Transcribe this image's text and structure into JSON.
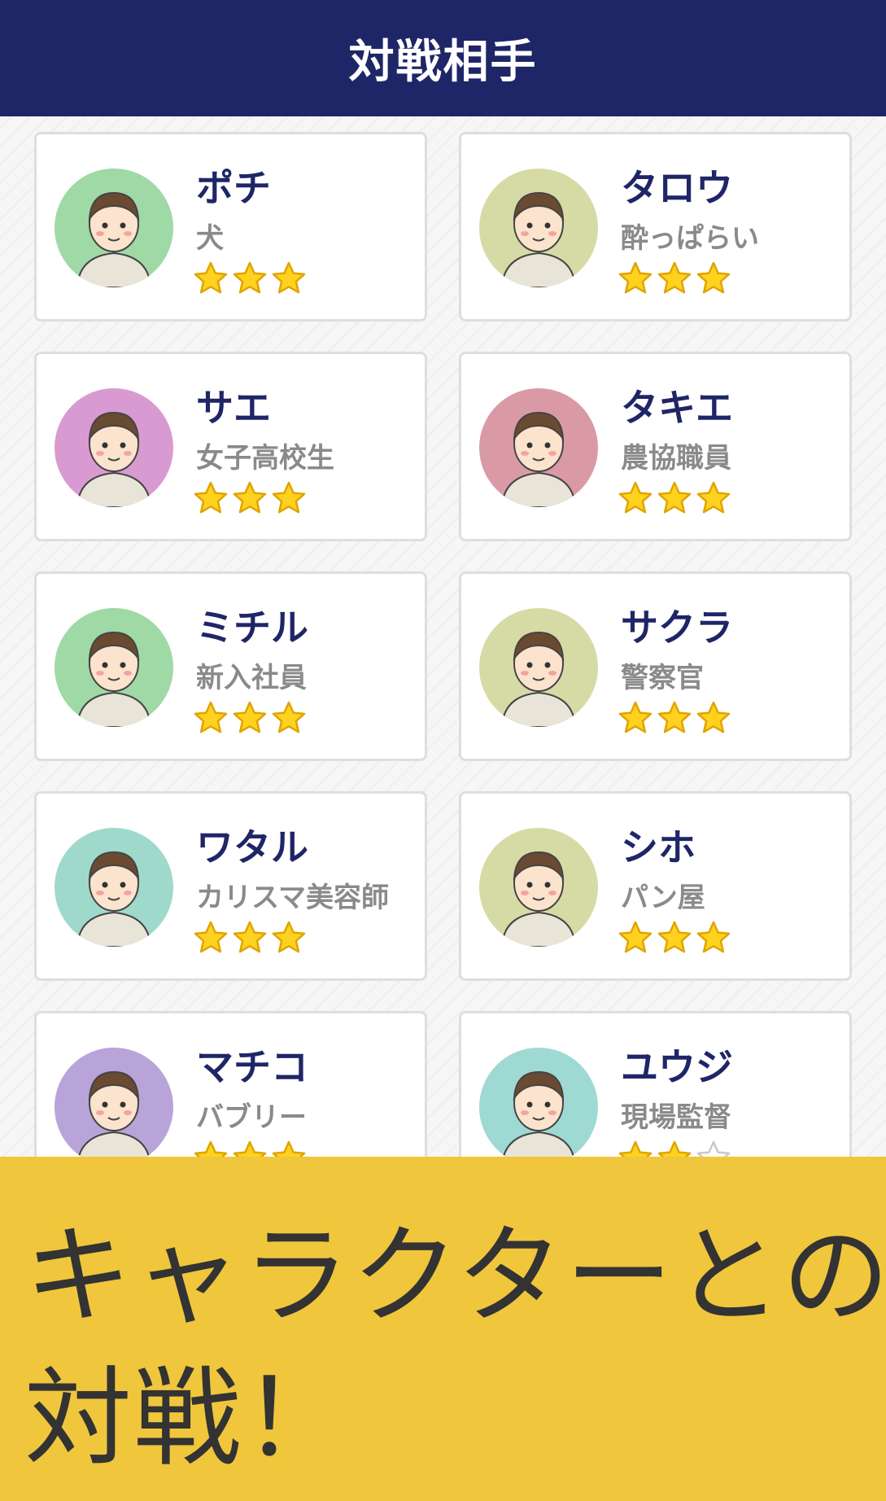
{
  "header": {
    "title": "対戦相手"
  },
  "opponents": [
    {
      "name": "ポチ",
      "role": "犬",
      "stars": 3,
      "avatar_bg": "#9fd9a6",
      "avatar": "shiba-dog-avatar"
    },
    {
      "name": "タロウ",
      "role": "酔っぱらい",
      "stars": 3,
      "avatar_bg": "#d6dba5",
      "avatar": "drunk-man-avatar"
    },
    {
      "name": "サエ",
      "role": "女子高校生",
      "stars": 3,
      "avatar_bg": "#d99ad2",
      "avatar": "schoolgirl-avatar"
    },
    {
      "name": "タキエ",
      "role": "農協職員",
      "stars": 3,
      "avatar_bg": "#d99aa6",
      "avatar": "farm-coop-worker-avatar"
    },
    {
      "name": "ミチル",
      "role": "新入社員",
      "stars": 3,
      "avatar_bg": "#9fd9a6",
      "avatar": "new-employee-avatar"
    },
    {
      "name": "サクラ",
      "role": "警察官",
      "stars": 3,
      "avatar_bg": "#d6dba5",
      "avatar": "police-officer-avatar"
    },
    {
      "name": "ワタル",
      "role": "カリスマ美容師",
      "stars": 3,
      "avatar_bg": "#9fd9cc",
      "avatar": "hairdresser-avatar"
    },
    {
      "name": "シホ",
      "role": "パン屋",
      "stars": 3,
      "avatar_bg": "#d6dba5",
      "avatar": "baker-avatar"
    },
    {
      "name": "マチコ",
      "role": "バブリー",
      "stars": 3,
      "avatar_bg": "#b9a4d9",
      "avatar": "bubbly-lady-avatar"
    },
    {
      "name": "ユウジ",
      "role": "現場監督",
      "stars": 2,
      "avatar_bg": "#9fd9d4",
      "avatar": "site-supervisor-avatar"
    }
  ],
  "banner": {
    "line1": "キャラクターとの",
    "line2": "対戦！"
  },
  "colors": {
    "header_bg": "#1f2667",
    "name_text": "#1f2667",
    "role_text": "#8a8a8a",
    "star_fill": "#ffd21f",
    "star_outline": "#e0a400",
    "banner_bg": "#f0c63c",
    "banner_text": "#333333"
  }
}
